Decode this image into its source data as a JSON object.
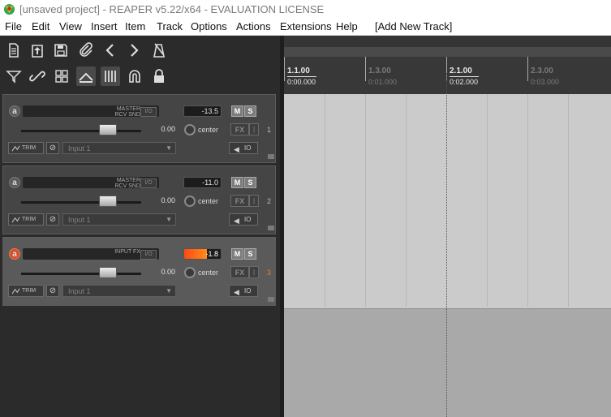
{
  "window": {
    "title": "[unsaved project] - REAPER v5.22/x64 - EVALUATION LICENSE"
  },
  "menu": {
    "items": [
      "File",
      "Edit",
      "View",
      "Insert",
      "Item",
      "Track",
      "Options",
      "Actions",
      "Extensions",
      "Help",
      "[Add New Track]"
    ]
  },
  "toolbar": {
    "row1": [
      "new-project-icon",
      "open-project-icon",
      "save-project-icon",
      "project-settings-icon",
      "undo-icon",
      "redo-icon",
      "metronome-icon"
    ],
    "row2": [
      "ripple-edit-icon",
      "item-grouping-icon",
      "snap-grid-icon",
      "envelope-points-icon",
      "grid-lines-icon",
      "snap-magnet-icon",
      "lock-icon"
    ]
  },
  "ruler": {
    "marks": [
      {
        "bar": "1.1.00",
        "time": "0:00.000",
        "emphasis": "major"
      },
      {
        "bar": "1.3.00",
        "time": "0:01.000",
        "emphasis": "minor"
      },
      {
        "bar": "2.1.00",
        "time": "0:02.000",
        "emphasis": "major"
      },
      {
        "bar": "2.3.00",
        "time": "0:03.000",
        "emphasis": "minor"
      }
    ]
  },
  "tracks": [
    {
      "number": "1",
      "name": "",
      "master_label": "MASTER",
      "send_label": "RCV SND",
      "io_label": "I/O",
      "meter": "-13.5",
      "volume": "0.00",
      "pan": "center",
      "fx": "FX",
      "input": "Input 1",
      "trim": "TRIM",
      "io_route": "IO",
      "mute": "M",
      "solo": "S",
      "selected": false
    },
    {
      "number": "2",
      "name": "",
      "master_label": "MASTER",
      "send_label": "RCV SND",
      "io_label": "I/O",
      "meter": "-11.0",
      "volume": "0.00",
      "pan": "center",
      "fx": "FX",
      "input": "Input 1",
      "trim": "TRIM",
      "io_route": "IO",
      "mute": "M",
      "solo": "S",
      "selected": false
    },
    {
      "number": "3",
      "name": "",
      "master_label": "INPUT FX",
      "send_label": "",
      "io_label": "I/O",
      "meter": "-1.8",
      "volume": "0.00",
      "pan": "center",
      "fx": "FX",
      "input": "Input 1",
      "trim": "TRIM",
      "io_route": "IO",
      "mute": "M",
      "solo": "S",
      "selected": true
    }
  ],
  "colors": {
    "record_armed": "#d6502b",
    "meter_hot": "#ff4a14"
  }
}
